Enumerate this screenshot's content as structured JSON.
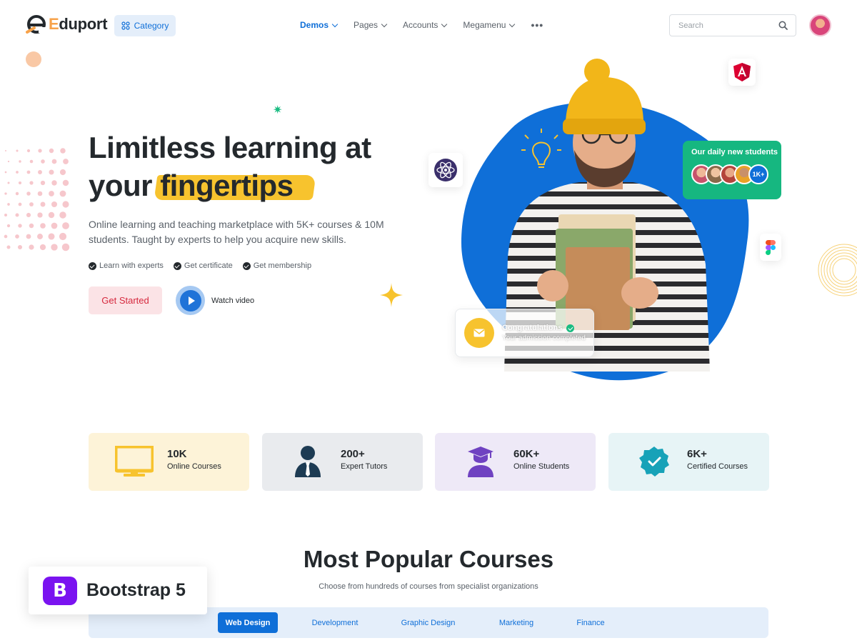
{
  "brand": {
    "logo_text_accent": "E",
    "logo_text_rest": "duport",
    "accent_color": "#f7a24a",
    "primary_color": "#0f6fd8"
  },
  "nav": {
    "category_label": "Category",
    "items": [
      {
        "label": "Demos",
        "active": true
      },
      {
        "label": "Pages"
      },
      {
        "label": "Accounts"
      },
      {
        "label": "Megamenu"
      }
    ],
    "more_icon": "ellipsis-icon"
  },
  "search": {
    "placeholder": "Search",
    "icon": "search-icon"
  },
  "hero": {
    "title_line1": "Limitless learning at",
    "title_line2_plain": "your",
    "title_line2_highlight": "fingertips",
    "subtitle": "Online learning and teaching marketplace with 5K+ courses & 10M students. Taught by experts to help you acquire new skills.",
    "features": [
      "Learn with experts",
      "Get certificate",
      "Get membership"
    ],
    "cta_label": "Get Started",
    "video_label": "Watch video"
  },
  "floating": {
    "students_title": "Our daily new students",
    "students_count": "1K+",
    "congrats_title": "Congratulations",
    "congrats_sub": "Your admission completed"
  },
  "stats": [
    {
      "number": "10K",
      "label": "Online Courses",
      "icon": "monitor-icon",
      "bg": "#fdf3d8",
      "color": "#f7c32e"
    },
    {
      "number": "200+",
      "label": "Expert Tutors",
      "icon": "tutor-icon",
      "bg": "#e9ebee",
      "color": "#1d3b53"
    },
    {
      "number": "60K+",
      "label": "Online Students",
      "icon": "graduate-icon",
      "bg": "#eee9f7",
      "color": "#6f42c1"
    },
    {
      "number": "6K+",
      "label": "Certified Courses",
      "icon": "certified-badge-icon",
      "bg": "#e7f4f6",
      "color": "#17a2b8"
    }
  ],
  "courses": {
    "title": "Most Popular Courses",
    "subtitle": "Choose from hundreds of courses from specialist organizations",
    "tabs": [
      {
        "label": "Web Design",
        "active": true
      },
      {
        "label": "Development"
      },
      {
        "label": "Graphic Design"
      },
      {
        "label": "Marketing"
      },
      {
        "label": "Finance"
      }
    ]
  },
  "badge": {
    "logo_letter": "B",
    "text": "Bootstrap 5"
  }
}
